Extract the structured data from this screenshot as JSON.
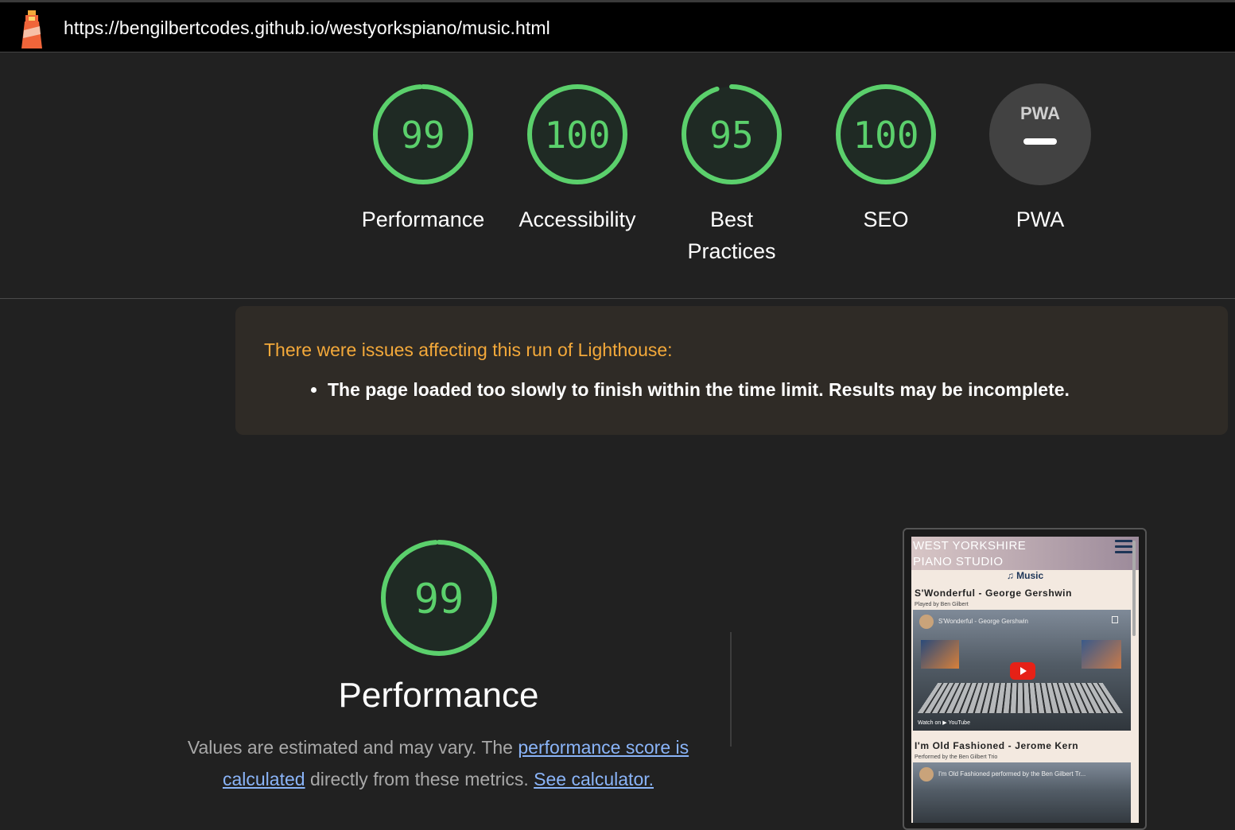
{
  "browser": {
    "url": "https://bengilbertcodes.github.io/westyorkspiano/music.html"
  },
  "scores": [
    {
      "label": "Performance",
      "value": "99",
      "score": 0.99,
      "color": "#0cce6b"
    },
    {
      "label": "Accessibility",
      "value": "100",
      "score": 1.0,
      "color": "#0cce6b"
    },
    {
      "label": "Best\nPractices",
      "value": "95",
      "score": 0.95,
      "color": "#0cce6b"
    },
    {
      "label": "SEO",
      "value": "100",
      "score": 1.0,
      "color": "#0cce6b"
    },
    {
      "label": "PWA",
      "value": "PWA",
      "score": null,
      "color": "#424242"
    }
  ],
  "warning": {
    "title": "There were issues affecting this run of Lighthouse:",
    "items": [
      "The page loaded too slowly to finish within the time limit. Results may be incomplete."
    ]
  },
  "performance": {
    "value": "99",
    "score": 0.99,
    "title": "Performance",
    "desc_prefix": "Values are estimated and may vary. The ",
    "link1": "performance score is calculated",
    "desc_middle": " directly from these metrics. ",
    "link2": "See calculator."
  },
  "screenshot": {
    "site_title": "WEST YORKSHIRE\nPIANO STUDIO",
    "nav": "♫ Music",
    "songs": [
      {
        "title": "S'Wonderful - George Gershwin",
        "sub": "Played by Ben Gilbert",
        "video_title": "S'Wonderful - George Gershwin",
        "watch": "Watch on ▶ YouTube"
      },
      {
        "title": "I'm Old Fashioned - Jerome Kern",
        "sub": "Performed by the Ben Gilbert Trio",
        "video_title": "I'm Old Fashioned performed by the Ben Gilbert Tr...",
        "watch": ""
      }
    ]
  },
  "colors": {
    "pass": "#0cce6b",
    "pass_text": "#0cce6b",
    "warning_title": "#f4a93a",
    "link": "#8ab4f8"
  }
}
